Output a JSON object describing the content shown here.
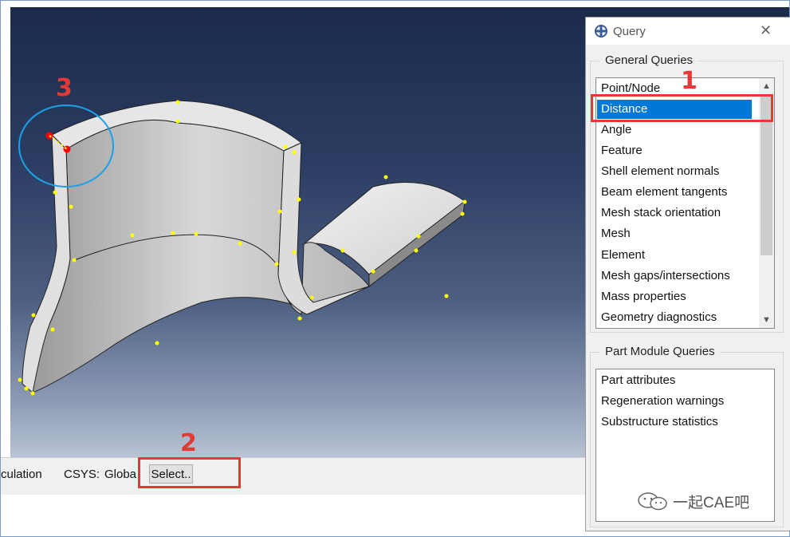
{
  "prompt_bar": {
    "text_calc": "culation",
    "text_csys": "CSYS:",
    "text_global": "Globa",
    "select_button": "Select.."
  },
  "query_dialog": {
    "title": "Query",
    "close_glyph": "✕",
    "general_queries": {
      "title": "General Queries",
      "items": [
        "Point/Node",
        "Distance",
        "Angle",
        "Feature",
        "Shell element normals",
        "Beam element tangents",
        "Mesh stack orientation",
        "Mesh",
        "Element",
        "Mesh gaps/intersections",
        "Mass properties",
        "Geometry diagnostics"
      ],
      "selected": "Distance"
    },
    "part_module_queries": {
      "title": "Part Module Queries",
      "items": [
        "Part attributes",
        "Regeneration warnings",
        "Substructure statistics"
      ]
    },
    "scroll_up_glyph": "▲",
    "scroll_down_glyph": "▼"
  },
  "annotations": {
    "label_1": "1",
    "label_2": "2",
    "label_3": "3"
  },
  "watermark": {
    "text": "一起CAE吧"
  },
  "icons": {
    "query": "query-icon",
    "wechat": "wechat-icon",
    "close": "close-icon"
  },
  "colors": {
    "highlight": "#e53935",
    "selection": "#0078d7",
    "circle": "#1ea0e6",
    "vertex": "#ffff00",
    "pick_point": "#ff0000"
  }
}
